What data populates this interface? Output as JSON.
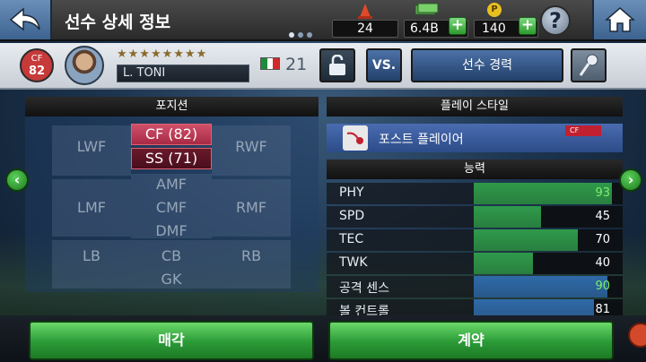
{
  "header": {
    "title": "선수 상세 정보",
    "currency": {
      "cone": "24",
      "cash": "6.4B",
      "points": "140",
      "points_icon": "P"
    },
    "help_icon": "?"
  },
  "player": {
    "position": "CF",
    "rating": "82",
    "stars": "★★★★★★★★",
    "name": "L. TONI",
    "number": "21",
    "flag_colors": [
      "#1e8a3a",
      "#ffffff",
      "#d22a2a"
    ],
    "vs_label": "VS.",
    "career_label": "선수 경력"
  },
  "positions": {
    "title": "포지션",
    "cells": {
      "lwf": "LWF",
      "rwf": "RWF",
      "amf": "AMF",
      "lmf": "LMF",
      "cmf": "CMF",
      "rmf": "RMF",
      "dmf": "DMF",
      "lb": "LB",
      "cb": "CB",
      "rb": "RB",
      "gk": "GK"
    },
    "primary": "CF (82)",
    "secondary": "SS (71)"
  },
  "playstyle": {
    "title": "플레이 스타일",
    "name": "포스트 플레이어",
    "tag": "CF"
  },
  "abilities": {
    "title": "능력",
    "rows": [
      {
        "label": "PHY",
        "value": 93,
        "color": "#2f9a4a",
        "val_color": "#7af06a"
      },
      {
        "label": "SPD",
        "value": 45,
        "color": "#2f9a4a",
        "val_color": "#ffffff"
      },
      {
        "label": "TEC",
        "value": 70,
        "color": "#2f9a4a",
        "val_color": "#ffffff"
      },
      {
        "label": "TWK",
        "value": 40,
        "color": "#2f9a4a",
        "val_color": "#ffffff"
      },
      {
        "label": "공격 센스",
        "value": 90,
        "color": "#2f6aa8",
        "val_color": "#7af06a"
      },
      {
        "label": "볼 컨트롤",
        "value": 81,
        "color": "#2f6aa8",
        "val_color": "#ffffff"
      }
    ]
  },
  "actions": {
    "sell": "매각",
    "contract": "계약"
  },
  "nav": {
    "prev": "‹",
    "next": "›"
  }
}
